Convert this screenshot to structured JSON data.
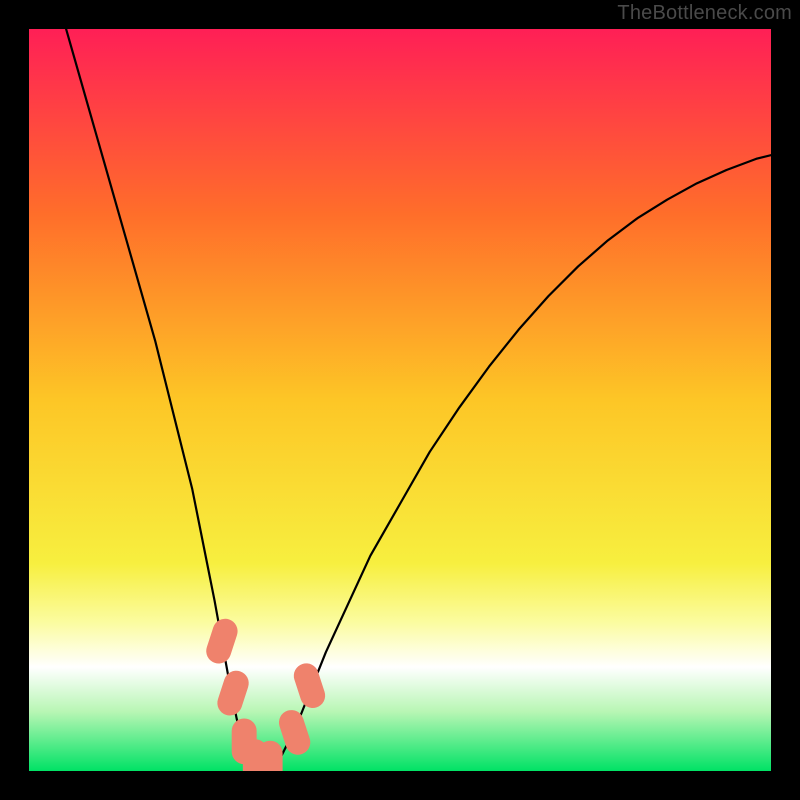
{
  "watermark": "TheBottleneck.com",
  "chart_data": {
    "type": "line",
    "title": "",
    "xlabel": "",
    "ylabel": "",
    "xlim": [
      0,
      100
    ],
    "ylim": [
      0,
      100
    ],
    "background": {
      "kind": "vertical-gradient",
      "stops": [
        {
          "offset": 0.0,
          "color": "#ff1f56"
        },
        {
          "offset": 0.25,
          "color": "#ff6e2a"
        },
        {
          "offset": 0.5,
          "color": "#fdc626"
        },
        {
          "offset": 0.72,
          "color": "#f7ef3f"
        },
        {
          "offset": 0.8,
          "color": "#fbfca0"
        },
        {
          "offset": 0.86,
          "color": "#ffffff"
        },
        {
          "offset": 0.92,
          "color": "#b8f6b4"
        },
        {
          "offset": 1.0,
          "color": "#00e265"
        }
      ]
    },
    "series": [
      {
        "name": "bottleneck-curve",
        "color": "#000000",
        "x": [
          5,
          6,
          7,
          8,
          9,
          10,
          11,
          12,
          13,
          14,
          15,
          16,
          17,
          18,
          19,
          20,
          21,
          22,
          23,
          24,
          25,
          26,
          27,
          28,
          29,
          30,
          31,
          32,
          34,
          36,
          38,
          40,
          43,
          46,
          50,
          54,
          58,
          62,
          66,
          70,
          74,
          78,
          82,
          86,
          90,
          94,
          98,
          100
        ],
        "y": [
          100,
          96.5,
          93,
          89.5,
          86,
          82.5,
          79,
          75.5,
          72,
          68.5,
          65,
          61.5,
          58,
          54,
          50,
          46,
          42,
          38,
          33,
          28,
          23,
          17.5,
          12,
          7,
          3.5,
          1.2,
          0.3,
          0.3,
          2.0,
          6.0,
          11,
          16,
          22.5,
          29,
          36,
          43,
          49,
          54.5,
          59.5,
          64,
          68,
          71.5,
          74.5,
          77,
          79.2,
          81,
          82.5,
          83
        ]
      }
    ],
    "markers": [
      {
        "name": "dot-1",
        "x": 26.0,
        "y": 17.5,
        "r": 1.4,
        "color": "#ef826c"
      },
      {
        "name": "dot-2",
        "x": 27.5,
        "y": 10.5,
        "r": 1.4,
        "color": "#ef826c"
      },
      {
        "name": "dot-3",
        "x": 29.0,
        "y": 4.0,
        "r": 1.4,
        "color": "#ef826c"
      },
      {
        "name": "dot-4",
        "x": 30.5,
        "y": 1.2,
        "r": 1.4,
        "color": "#ef826c"
      },
      {
        "name": "dot-5",
        "x": 32.5,
        "y": 1.0,
        "r": 1.4,
        "color": "#ef826c"
      },
      {
        "name": "dot-6",
        "x": 35.8,
        "y": 5.2,
        "r": 1.4,
        "color": "#ef826c"
      },
      {
        "name": "dot-7",
        "x": 37.8,
        "y": 11.5,
        "r": 1.4,
        "color": "#ef826c"
      }
    ]
  }
}
